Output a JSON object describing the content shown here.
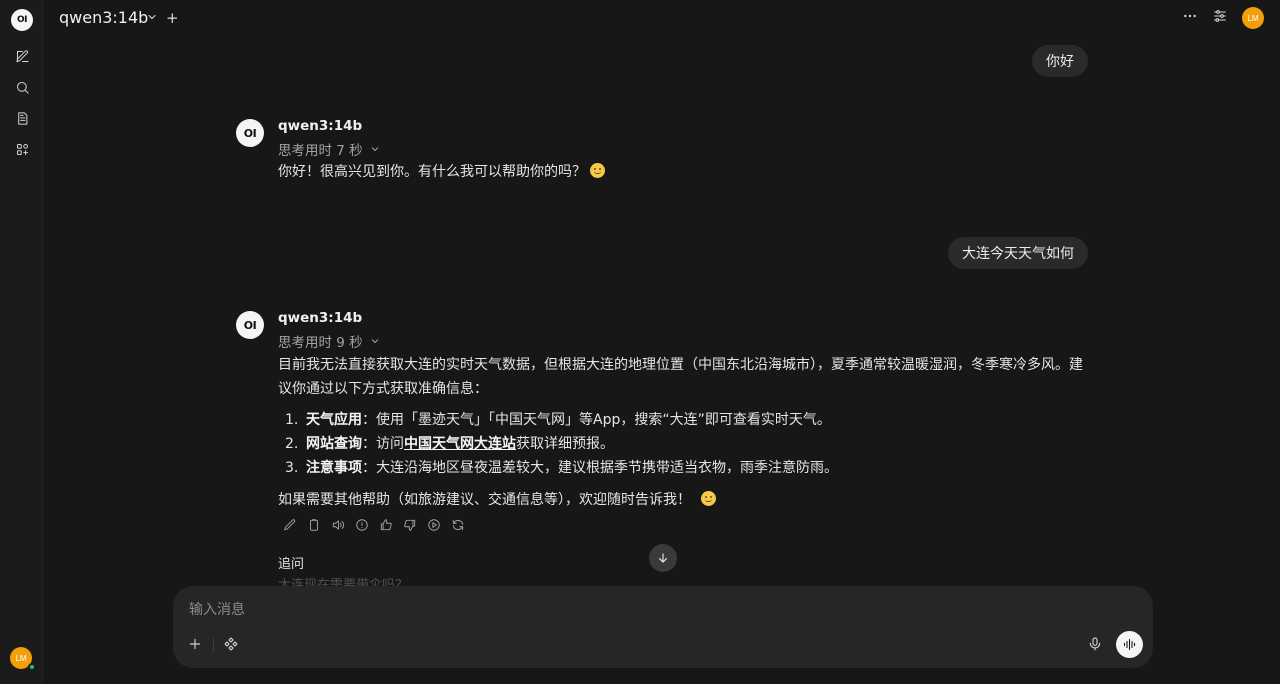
{
  "header": {
    "model_name": "qwen3:14b",
    "new_chat_plus": "+",
    "user_initials": "LM"
  },
  "sidebar": {
    "logo_text": "OI",
    "user_initials": "LM"
  },
  "messages": [
    {
      "role": "user",
      "text": "你好"
    },
    {
      "role": "assistant",
      "avatar": "OI",
      "model": "qwen3:14b",
      "thinking": "思考用时 7 秒",
      "text": "你好！很高兴见到你。有什么我可以帮助你的吗？"
    },
    {
      "role": "user",
      "text": "大连今天天气如何"
    },
    {
      "role": "assistant",
      "avatar": "OI",
      "model": "qwen3:14b",
      "thinking": "思考用时 9 秒",
      "intro": "目前我无法直接获取大连的实时天气数据，但根据大连的地理位置（中国东北沿海城市），夏季通常较温暖湿润，冬季寒冷多风。建议你通过以下方式获取准确信息：",
      "list": [
        {
          "num": "1.",
          "bold": "天气应用",
          "pre": "：使用「墨迹天气」「中国天气网」等App，搜索“大连”即可查看实时天气。",
          "link": "",
          "post": ""
        },
        {
          "num": "2.",
          "bold": "网站查询",
          "pre": "：访问",
          "link": "中国天气网大连站",
          "post": "获取详细预报。"
        },
        {
          "num": "3.",
          "bold": "注意事项",
          "pre": "：大连沿海地区昼夜温差较大，建议根据季节携带适当衣物，雨季注意防雨。",
          "link": "",
          "post": ""
        }
      ],
      "outro": "如果需要其他帮助（如旅游建议、交通信息等），欢迎随时告诉我！"
    }
  ],
  "followup": {
    "label": "追问",
    "first_item": "大连现在需要带伞吗？"
  },
  "composer": {
    "placeholder": "输入消息"
  },
  "colors": {
    "background": "#171717",
    "bubble": "#2a2a2a",
    "composer": "#262626",
    "avatar_orange": "#f59e0b",
    "online_green": "#22c55e"
  }
}
